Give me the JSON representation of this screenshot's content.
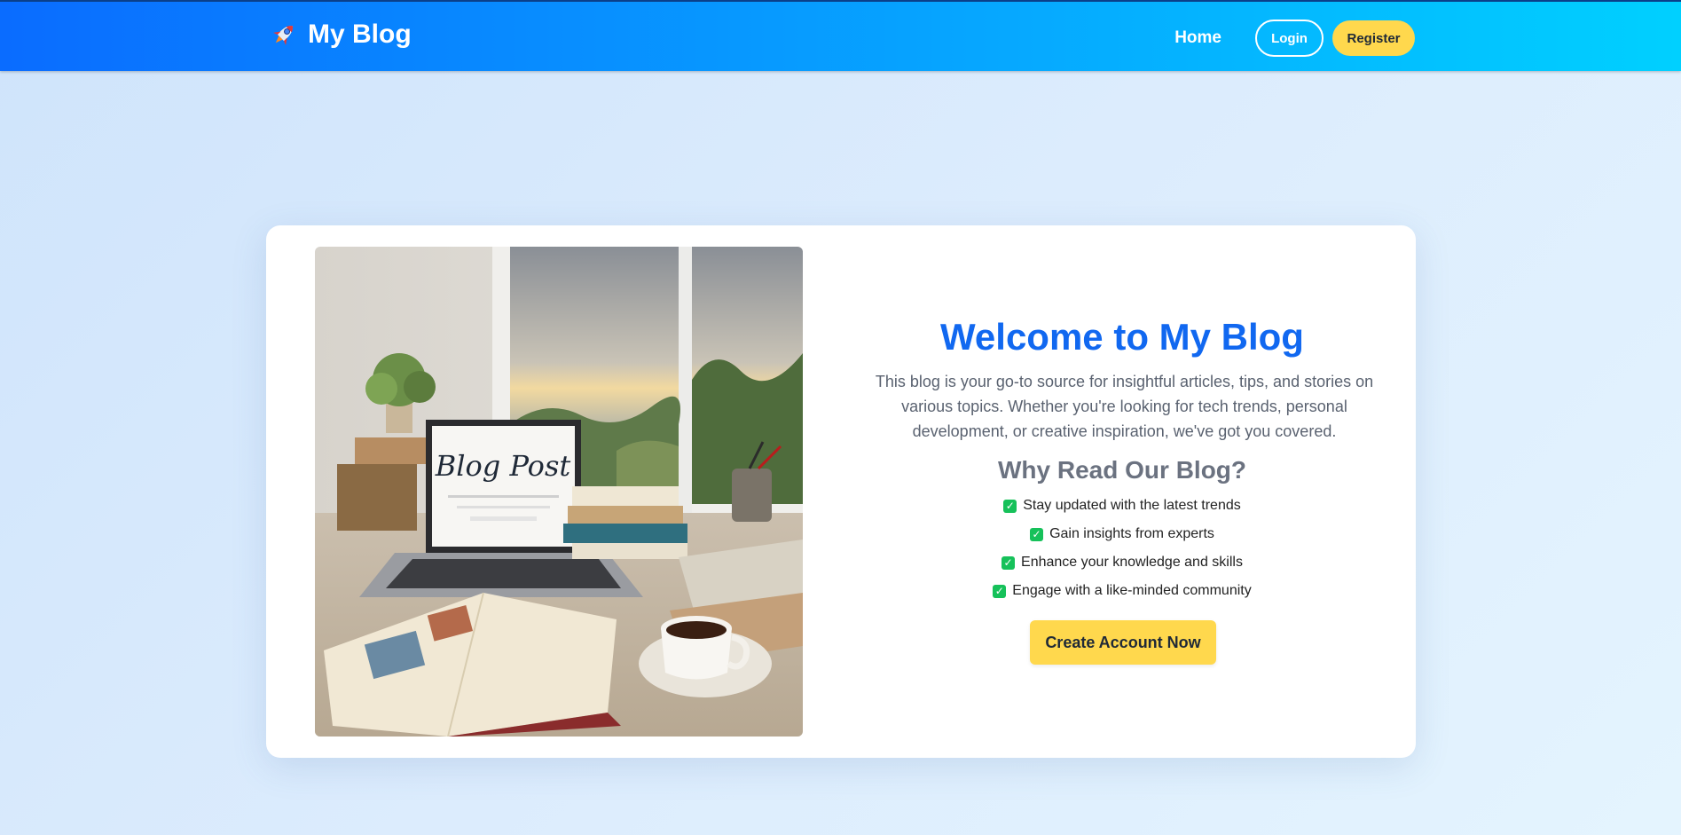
{
  "navbar": {
    "brand": "My Blog",
    "brand_icon": "rocket-icon",
    "links": {
      "home": "Home",
      "login": "Login",
      "register": "Register"
    }
  },
  "hero": {
    "image_alt": "Laptop showing Blog Post on desk by window",
    "image_text": "Blog Post",
    "title": "Welcome to My Blog",
    "intro": "This blog is your go-to source for insightful articles, tips, and stories on various topics. Whether you're looking for tech trends, personal development, or creative inspiration, we've got you covered.",
    "why_title": "Why Read Our Blog?",
    "benefits": [
      "Stay updated with the latest trends",
      "Gain insights from experts",
      "Enhance your knowledge and skills",
      "Engage with a like-minded community"
    ],
    "cta": "Create Account Now"
  },
  "colors": {
    "nav_start": "#0a6cff",
    "nav_end": "#00d0ff",
    "title_blue": "#1168f0",
    "accent_yellow": "#ffd84d",
    "check_green": "#16c15a"
  }
}
